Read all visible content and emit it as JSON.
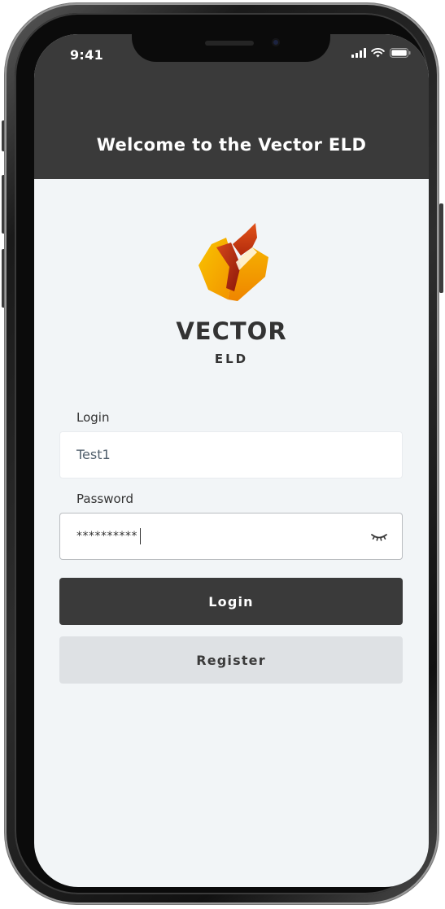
{
  "status_bar": {
    "time": "9:41",
    "signal_icon": "cellular-signal-icon",
    "wifi_icon": "wifi-icon",
    "battery_icon": "battery-icon"
  },
  "header": {
    "title": "Welcome to the Vector ELD",
    "background": "#3a3a3a"
  },
  "brand": {
    "logo_icon": "vector-logo-icon",
    "name": "VECTOR",
    "sub": "ELD",
    "colors": [
      "#f7b500",
      "#f08a00",
      "#c83a0e",
      "#8e1a0a"
    ]
  },
  "form": {
    "login": {
      "label": "Login",
      "value": "Test1"
    },
    "password": {
      "label": "Password",
      "value": "**********",
      "toggle_icon": "eye-closed-icon"
    }
  },
  "buttons": {
    "login": "Login",
    "register": "Register"
  },
  "colors": {
    "screen_bg": "#f2f5f7",
    "primary_button": "#3a3a3a",
    "secondary_button": "#dee1e4"
  }
}
